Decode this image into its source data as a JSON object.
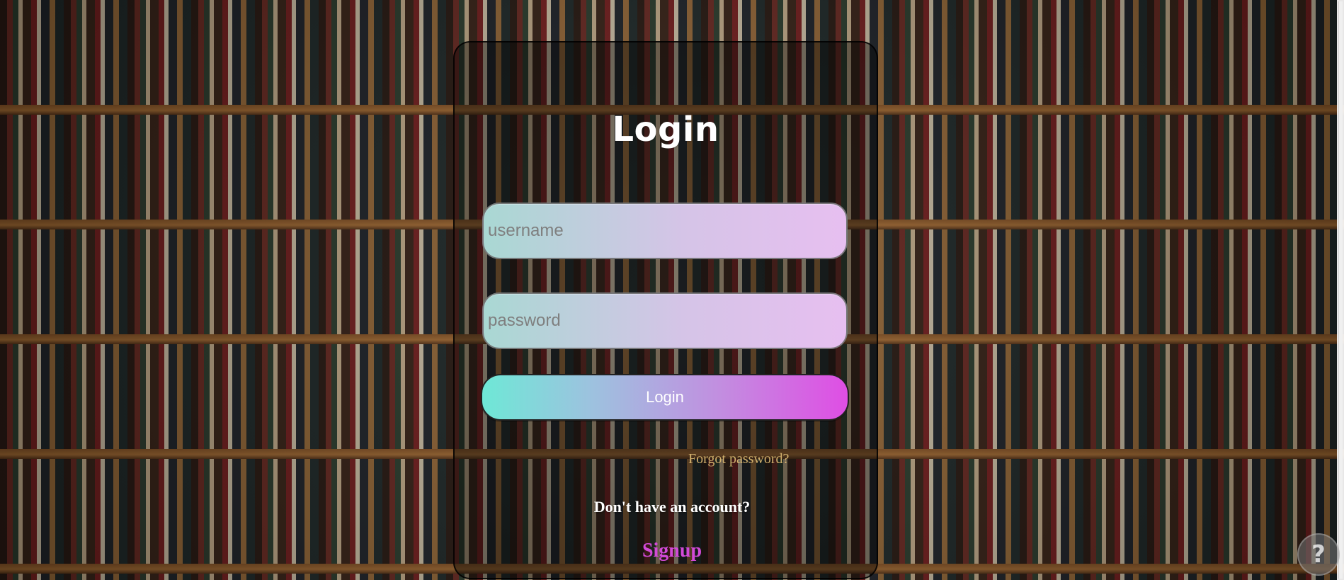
{
  "title": "Login",
  "form": {
    "username_placeholder": "username",
    "password_placeholder": "password",
    "login_button": "Login",
    "forgot_password": "Forgot password?",
    "no_account_text": "Don't have an account?",
    "signup_link": "Signup"
  },
  "colors": {
    "title_text": "#ffffff",
    "signup_text": "#d24ad8",
    "forgot_text": "#d1b06d",
    "button_gradient_start": "#6ee8d6",
    "button_gradient_end": "#df4ee4",
    "input_gradient_start": "#a9d8d3",
    "input_gradient_end": "#e7bff0"
  },
  "icons": {
    "corner_badge": "corner-badge-icon"
  }
}
